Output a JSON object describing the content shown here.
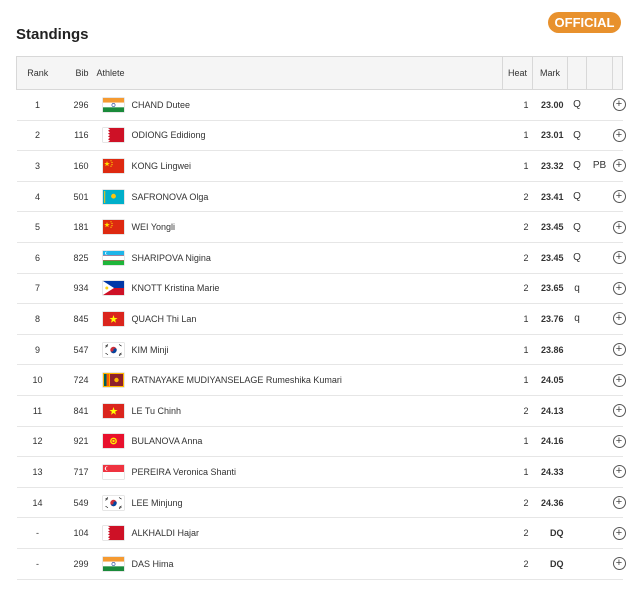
{
  "page": {
    "title": "Standings",
    "status_badge": "OFFICIAL"
  },
  "colors": {
    "badge": "#e8912d",
    "header_bg": "#f5f5f5"
  },
  "columns": {
    "rank": "Rank",
    "bib": "Bib",
    "athlete": "Athlete",
    "heat": "Heat",
    "mark": "Mark"
  },
  "rows": [
    {
      "rank": "1",
      "bib": "296",
      "flag": "IND",
      "athlete": "CHAND Dutee",
      "heat": "1",
      "mark": "23.00",
      "q": "Q",
      "note": ""
    },
    {
      "rank": "2",
      "bib": "116",
      "flag": "BRN",
      "athlete": "ODIONG Edidiong",
      "heat": "1",
      "mark": "23.01",
      "q": "Q",
      "note": ""
    },
    {
      "rank": "3",
      "bib": "160",
      "flag": "CHN",
      "athlete": "KONG Lingwei",
      "heat": "1",
      "mark": "23.32",
      "q": "Q",
      "note": "PB"
    },
    {
      "rank": "4",
      "bib": "501",
      "flag": "KAZ",
      "athlete": "SAFRONOVA Olga",
      "heat": "2",
      "mark": "23.41",
      "q": "Q",
      "note": ""
    },
    {
      "rank": "5",
      "bib": "181",
      "flag": "CHN",
      "athlete": "WEI Yongli",
      "heat": "2",
      "mark": "23.45",
      "q": "Q",
      "note": ""
    },
    {
      "rank": "6",
      "bib": "825",
      "flag": "UZB",
      "athlete": "SHARIPOVA Nigina",
      "heat": "2",
      "mark": "23.45",
      "q": "Q",
      "note": ""
    },
    {
      "rank": "7",
      "bib": "934",
      "flag": "PHI",
      "athlete": "KNOTT Kristina Marie",
      "heat": "2",
      "mark": "23.65",
      "q": "q",
      "note": ""
    },
    {
      "rank": "8",
      "bib": "845",
      "flag": "VIE",
      "athlete": "QUACH Thi Lan",
      "heat": "1",
      "mark": "23.76",
      "q": "q",
      "note": ""
    },
    {
      "rank": "9",
      "bib": "547",
      "flag": "KOR",
      "athlete": "KIM Minji",
      "heat": "1",
      "mark": "23.86",
      "q": "",
      "note": ""
    },
    {
      "rank": "10",
      "bib": "724",
      "flag": "SRI",
      "athlete": "RATNAYAKE MUDIYANSELAGE Rumeshika Kumari",
      "heat": "1",
      "mark": "24.05",
      "q": "",
      "note": ""
    },
    {
      "rank": "11",
      "bib": "841",
      "flag": "VIE",
      "athlete": "LE Tu Chinh",
      "heat": "2",
      "mark": "24.13",
      "q": "",
      "note": ""
    },
    {
      "rank": "12",
      "bib": "921",
      "flag": "KGZ",
      "athlete": "BULANOVA Anna",
      "heat": "1",
      "mark": "24.16",
      "q": "",
      "note": ""
    },
    {
      "rank": "13",
      "bib": "717",
      "flag": "SGP",
      "athlete": "PEREIRA Veronica Shanti",
      "heat": "1",
      "mark": "24.33",
      "q": "",
      "note": ""
    },
    {
      "rank": "14",
      "bib": "549",
      "flag": "KOR",
      "athlete": "LEE Minjung",
      "heat": "2",
      "mark": "24.36",
      "q": "",
      "note": ""
    },
    {
      "rank": "-",
      "bib": "104",
      "flag": "BRN",
      "athlete": "ALKHALDI Hajar",
      "heat": "2",
      "mark": "DQ",
      "q": "",
      "note": ""
    },
    {
      "rank": "-",
      "bib": "299",
      "flag": "IND",
      "athlete": "DAS Hima",
      "heat": "2",
      "mark": "DQ",
      "q": "",
      "note": ""
    }
  ]
}
